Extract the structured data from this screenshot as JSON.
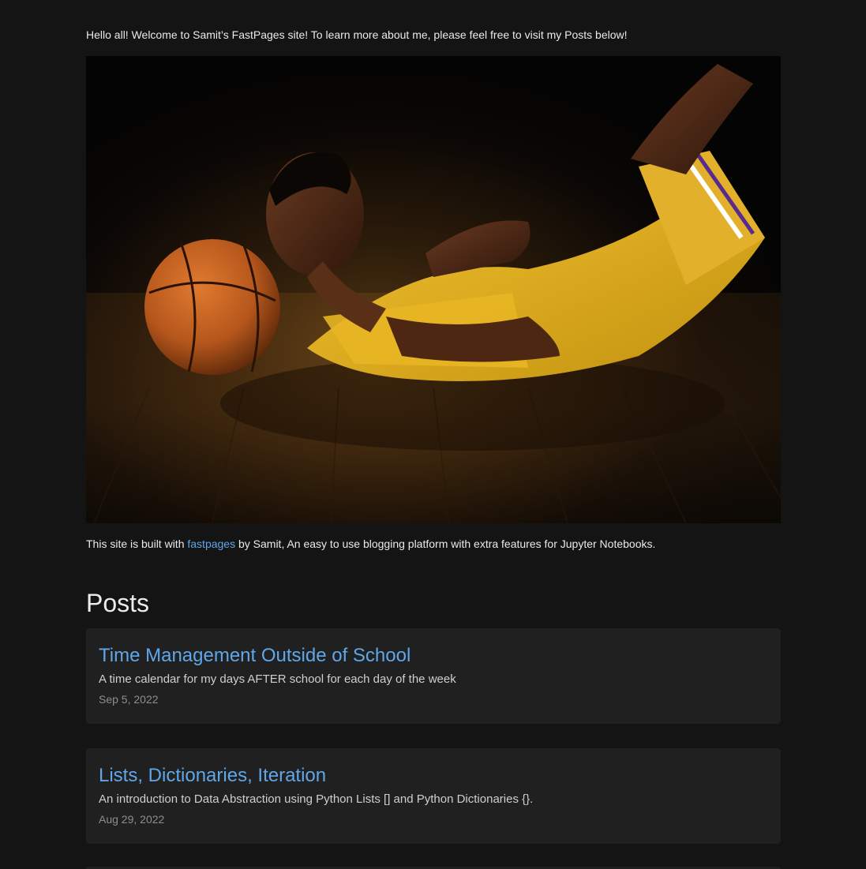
{
  "intro_text": "Hello all! Welcome to Samit’s FastPages site! To learn more about me, please feel free to visit my Posts below!",
  "hero_image": {
    "alt": "basketball player lying on a hardwood court"
  },
  "builtwith": {
    "prefix": "This site is built with ",
    "link_label": "fastpages",
    "suffix": " by Samit, An easy to use blogging platform with extra features for Jupyter Notebooks."
  },
  "posts": {
    "heading": "Posts",
    "items": [
      {
        "title": "Time Management Outside of School",
        "description": "A time calendar for my days AFTER school for each day of the week",
        "date": "Sep 5, 2022"
      },
      {
        "title": "Lists, Dictionaries, Iteration",
        "description": "An introduction to Data Abstraction using Python Lists [] and Python Dictionaries {}.",
        "date": "Aug 29, 2022"
      }
    ]
  },
  "colors": {
    "background": "#141414",
    "card": "#202021",
    "link": "#5fa7e8",
    "text": "#eaeaea",
    "muted": "#8e8e8e"
  }
}
